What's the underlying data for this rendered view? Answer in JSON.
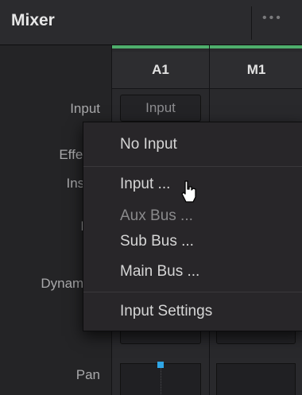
{
  "app": {
    "title": "Mixer",
    "more_menu": "•••"
  },
  "labels": {
    "input": "Input",
    "effects": "Effects",
    "insert": "Insert",
    "eq": "EQ",
    "dynamics": "Dynamics",
    "pan": "Pan"
  },
  "channels": [
    {
      "name": "A1",
      "input_button": "Input",
      "accent": "#4fae6c"
    },
    {
      "name": "M1",
      "accent": "#4fae6c"
    }
  ],
  "menu": {
    "items": [
      {
        "label": "No Input",
        "enabled": true
      },
      {
        "label": "Input ...",
        "enabled": true,
        "hovered": true
      },
      {
        "label": "Aux Bus ...",
        "enabled": false
      },
      {
        "label": "Sub Bus ...",
        "enabled": true
      },
      {
        "label": "Main Bus ...",
        "enabled": true
      },
      {
        "label": "Input Settings",
        "enabled": true
      }
    ]
  },
  "colors": {
    "accent_green": "#4fae6c",
    "pan_marker": "#2fa6e6"
  }
}
